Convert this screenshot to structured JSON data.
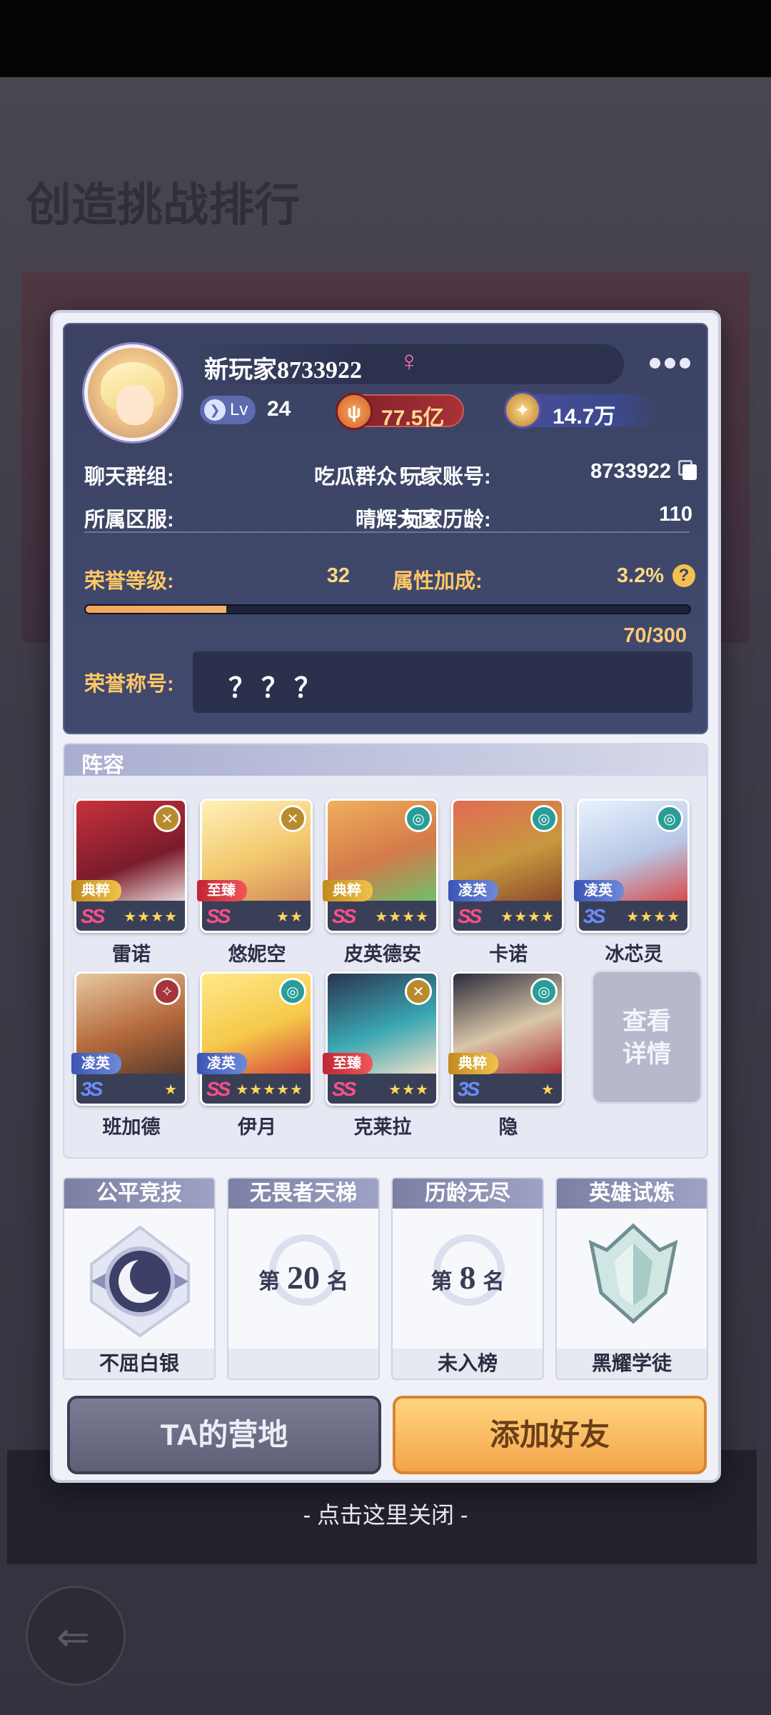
{
  "background": {
    "title": "创造挑战排行"
  },
  "profile": {
    "player_name": "新玩家8733922",
    "gender_symbol": "♀",
    "level_label": "Lv",
    "level": "24",
    "power": "77.5亿",
    "power_icon_glyph": "ψ",
    "gems": "14.7万",
    "gem_icon_glyph": "✦",
    "chat_group_label": "聊天群组:",
    "chat_group_value": "吃瓜群众！！",
    "account_label": "玩家账号:",
    "account_value": "8733922",
    "server_label": "所属区服:",
    "server_value": "晴辉大区",
    "age_label": "玩家历龄:",
    "age_value": "110",
    "honor_level_label": "荣誉等级:",
    "honor_level_value": "32",
    "attr_bonus_label": "属性加成:",
    "attr_bonus_value": "3.2%",
    "help_glyph": "?",
    "xp_text": "70/300",
    "xp_fraction": 0.2333,
    "honor_title_label": "荣誉称号:",
    "honor_title_value": "？？？"
  },
  "lineup": {
    "title": "阵容",
    "heroes": [
      {
        "name": "雷诺",
        "tag": "典粹",
        "grade": "SS",
        "stars": "★★★★",
        "faction": "✕"
      },
      {
        "name": "悠妮空",
        "tag": "至臻",
        "grade": "SS",
        "stars": "★★",
        "faction": "✕"
      },
      {
        "name": "皮英德安",
        "tag": "典粹",
        "grade": "SS",
        "stars": "★★★★",
        "faction": "◎"
      },
      {
        "name": "卡诺",
        "tag": "凌英",
        "grade": "SS",
        "stars": "★★★★",
        "faction": "◎"
      },
      {
        "name": "冰芯灵",
        "tag": "凌英",
        "grade": "3S",
        "stars": "★★★★",
        "faction": "◎"
      },
      {
        "name": "班加德",
        "tag": "凌英",
        "grade": "3S",
        "stars": "★",
        "faction": "✧"
      },
      {
        "name": "伊月",
        "tag": "凌英",
        "grade": "SS",
        "stars": "★★★★★",
        "faction": "◎"
      },
      {
        "name": "克莱拉",
        "tag": "至臻",
        "grade": "SS",
        "stars": "★★★",
        "faction": "✕"
      },
      {
        "name": "隐",
        "tag": "典粹",
        "grade": "3S",
        "stars": "★",
        "faction": "◎"
      }
    ],
    "detail_label_1": "查看",
    "detail_label_2": "详情"
  },
  "ranks": [
    {
      "title": "公平竞技",
      "footer": "不屈白银"
    },
    {
      "title": "无畏者天梯",
      "prefix": "第",
      "number": "20",
      "suffix": "名",
      "footer": ""
    },
    {
      "title": "历龄无尽",
      "prefix": "第",
      "number": "8",
      "suffix": "名",
      "footer": "未入榜"
    },
    {
      "title": "英雄试炼",
      "footer": "黑耀学徒"
    }
  ],
  "buttons": {
    "camp": "TA的营地",
    "add_friend": "添加好友"
  },
  "close_hint": "- 点击这里关闭 -"
}
